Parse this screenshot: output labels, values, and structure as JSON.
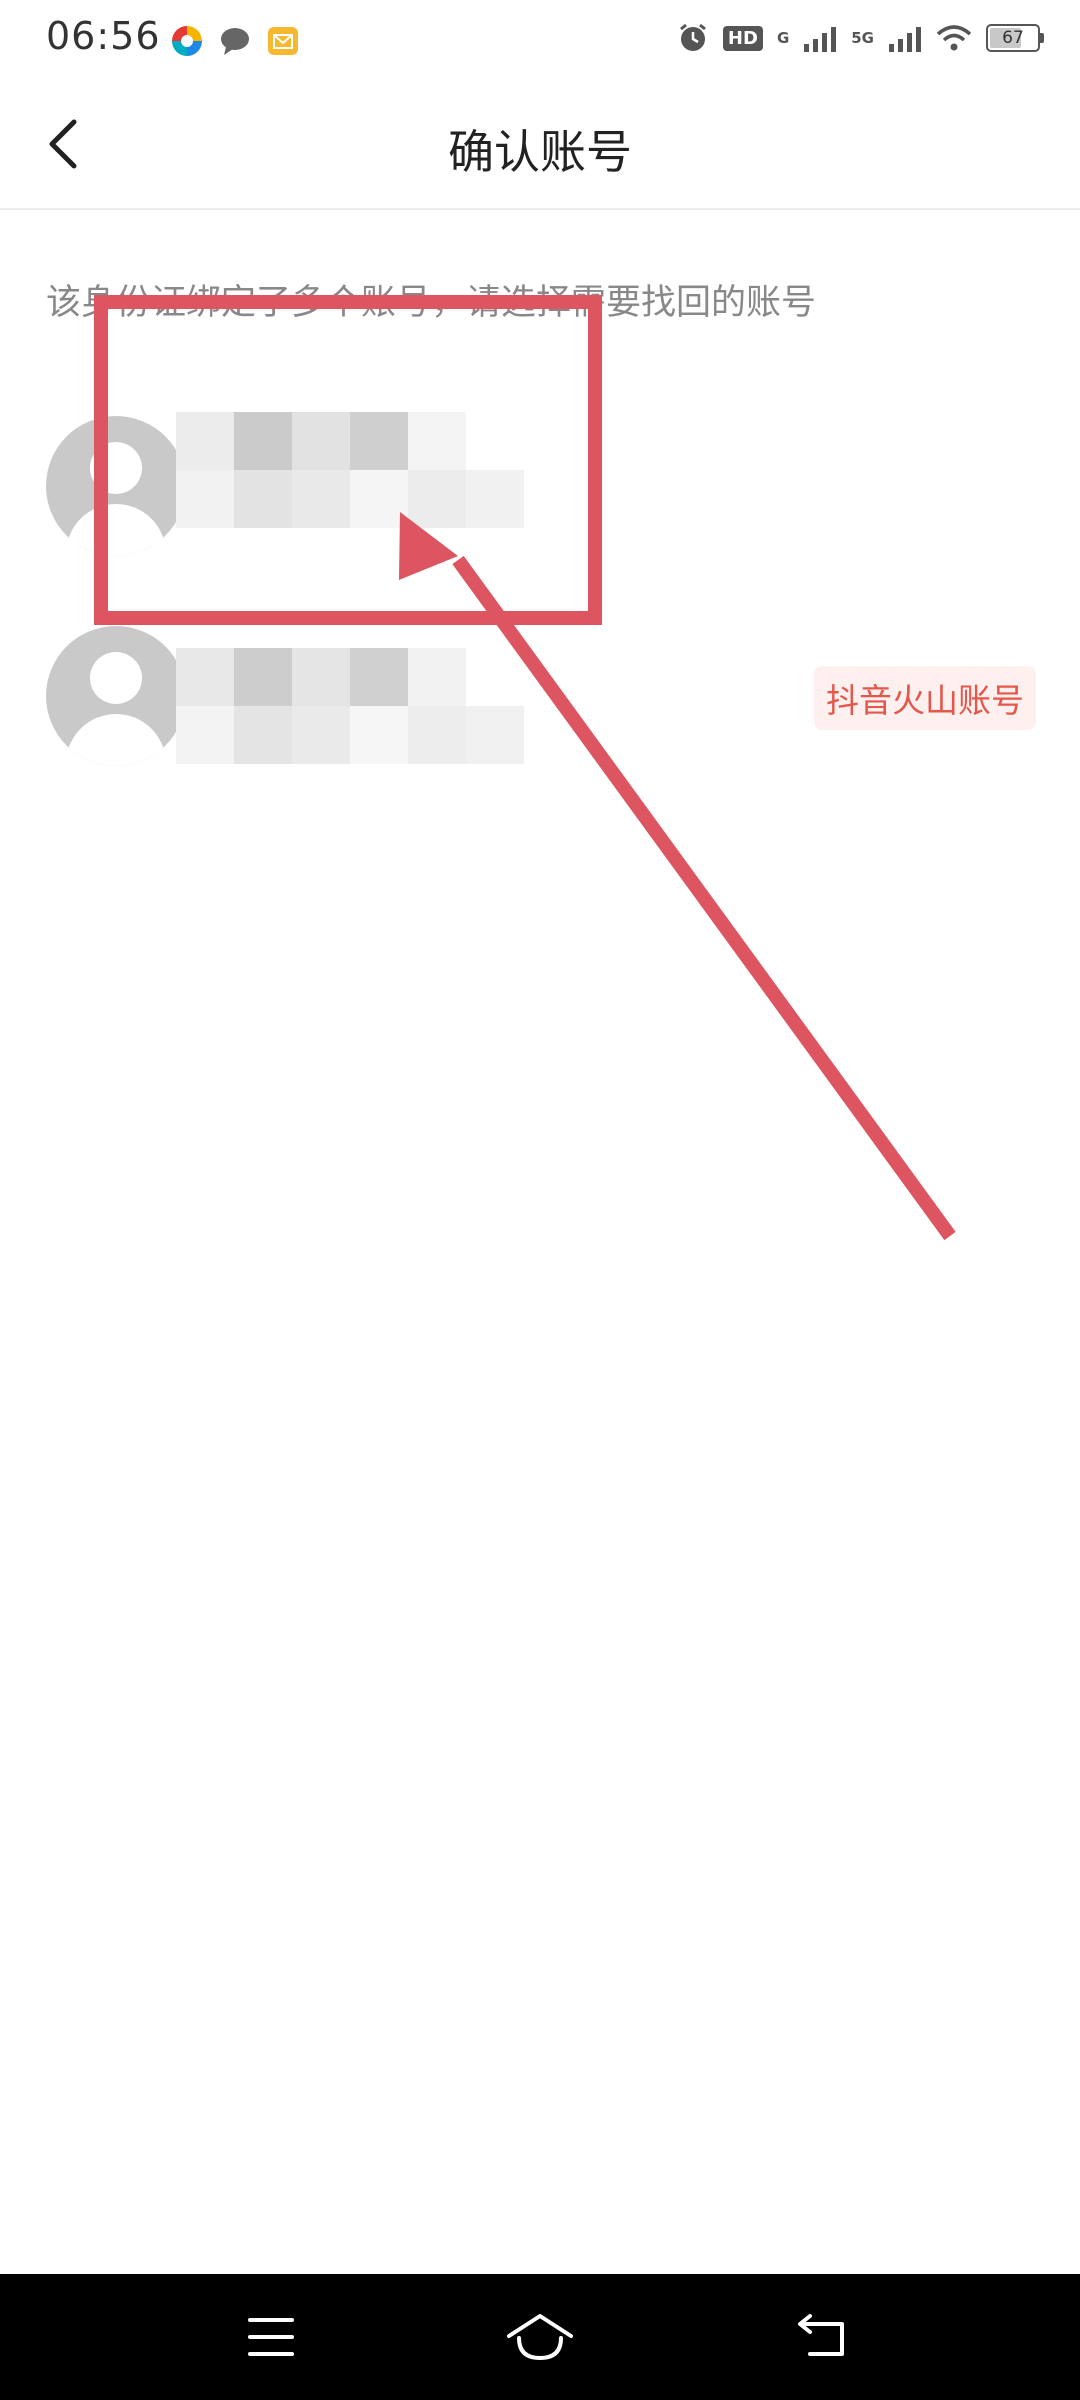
{
  "status_bar": {
    "time": "06:56",
    "hd_label": "HD",
    "signal_1_label": "G",
    "signal_2_label": "5G",
    "battery": "67",
    "battery_level": 0.67
  },
  "header": {
    "title": "确认账号"
  },
  "subtitle": "该身份证绑定了多个账号，请选择需要找回的账号",
  "accounts": [
    {
      "tag": ""
    },
    {
      "tag": "抖音火山账号"
    }
  ],
  "colors": {
    "accent": "#e4574a",
    "annotation": "#dc5560"
  }
}
